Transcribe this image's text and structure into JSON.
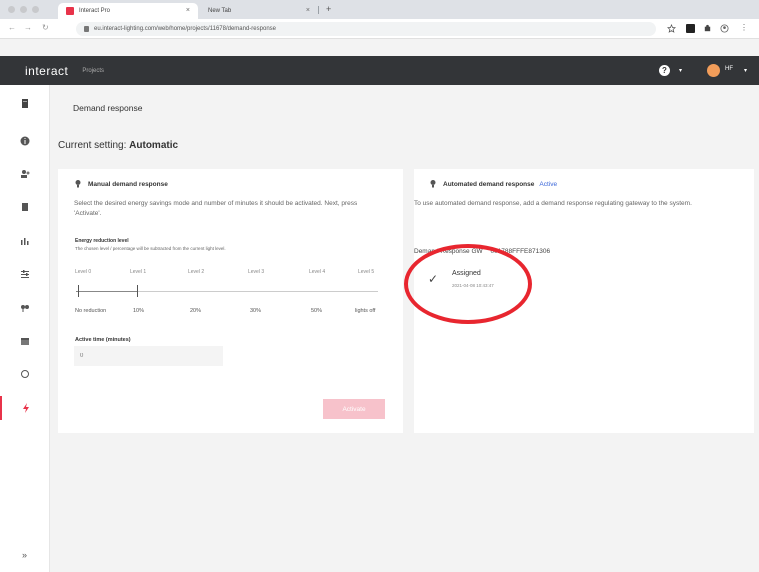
{
  "browser": {
    "tabs": [
      {
        "title": "Interact Pro",
        "close": "×"
      },
      {
        "title": "New Tab",
        "close": "×"
      }
    ],
    "new_tab": "+",
    "url": "eu.interact-lighting.com/web/home/projects/11678/demand-response"
  },
  "app": {
    "logo": "interact",
    "nav_projects": "Projects",
    "help_icon": "?",
    "user_initials": "HF"
  },
  "sidebar": {
    "items": [
      {
        "icon": "building-icon"
      },
      {
        "icon": "info-icon"
      },
      {
        "icon": "users-icon"
      },
      {
        "icon": "document-icon"
      },
      {
        "icon": "chart-icon"
      },
      {
        "icon": "sliders-icon"
      },
      {
        "icon": "location-icon"
      },
      {
        "icon": "calendar-icon"
      },
      {
        "icon": "sync-icon"
      },
      {
        "icon": "lightning-icon"
      }
    ],
    "expand": "»"
  },
  "page": {
    "title": "Demand response",
    "current_setting_label": "Current setting:",
    "current_setting_value": "Automatic"
  },
  "manual": {
    "title": "Manual demand response",
    "description": "Select the desired energy savings mode and number of minutes it should be activated. Next, press 'Activate'.",
    "energy_label": "Energy reduction level",
    "energy_note": "The chosen level / percentage will be subtracted from the current light level.",
    "levels": [
      "Level 0",
      "Level 1",
      "Level 2",
      "Level 3",
      "Level 4",
      "Level 5"
    ],
    "reductions": [
      "No reduction",
      "10%",
      "20%",
      "30%",
      "50%",
      "lights off"
    ],
    "active_time_label": "Active time (minutes)",
    "active_time_placeholder": "0",
    "activate_label": "Activate"
  },
  "automated": {
    "title": "Automated demand response",
    "status": "Active",
    "description": "To use automated demand response, add a demand response regulating gateway to the system.",
    "gateway_label": "Demand Response GW",
    "gateway_value": "001788FFFE871306",
    "assigned_label": "Assigned",
    "assigned_date": "2021-04-08 10:43:47"
  },
  "colors": {
    "accent": "#e8334a",
    "annotation": "#e8262f",
    "link": "#3a66d9",
    "header": "#333538"
  }
}
